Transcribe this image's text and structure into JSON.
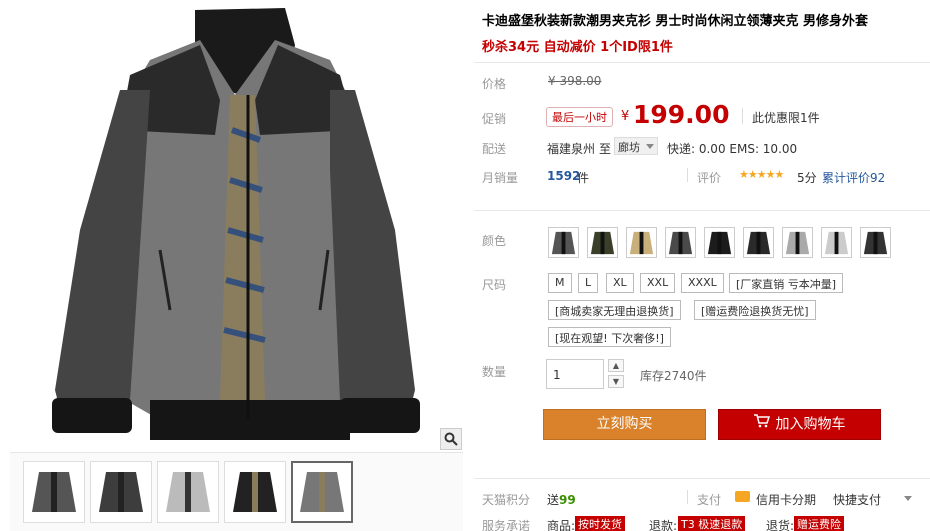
{
  "product": {
    "title": "卡迪盛堡秋装新款潮男夹克衫 男士时尚休闲立领薄夹克 男修身外套",
    "promo": "秒杀34元 自动减价 1个ID限1件"
  },
  "price": {
    "label": "价格",
    "original": "¥ 398.00",
    "promo_label": "促销",
    "promo_tag": "最后一小时",
    "currency": "¥",
    "current": "199.00",
    "limit_text": "此优惠限1件"
  },
  "shipping": {
    "label": "配送",
    "from": "福建泉州",
    "to_word": "至",
    "to_city": "廊坊",
    "fee": "快递: 0.00 EMS: 10.00"
  },
  "sales": {
    "label": "月销量",
    "count": "1592",
    "unit": "件",
    "review_label": "评价",
    "stars": "★★★★★",
    "score": "5分",
    "cum_reviews": "累计评价92"
  },
  "color": {
    "label": "颜色",
    "swatches": [
      "black-grey",
      "black-olive",
      "khaki",
      "dark-grey",
      "black",
      "black-white",
      "light-grey",
      "grey-white",
      "charcoal"
    ]
  },
  "size": {
    "label": "尺码",
    "options": [
      "M",
      "L",
      "XL",
      "XXL",
      "XXXL",
      "[厂家直销 亏本冲量]",
      "[商城卖家无理由退换货]",
      "[赠运费险退换货无忧]",
      "[现在观望! 下次奢侈!]"
    ]
  },
  "quantity": {
    "label": "数量",
    "value": "1",
    "stock": "库存2740件"
  },
  "actions": {
    "buy": "立刻购买",
    "cart": "加入购物车"
  },
  "points": {
    "label": "天猫积分",
    "prefix": "送",
    "value": "99",
    "pay_label": "支付",
    "card": "信用卡分期",
    "quick": "快捷支付"
  },
  "service": {
    "label": "服务承诺",
    "goods_label": "商品:",
    "goods_badge": "按时发货",
    "refund_label": "退款:",
    "refund_badge": "T3 极速退款",
    "return_label": "退货:",
    "return_badge": "赠运费险"
  },
  "colors": {
    "accent_red": "#c40000",
    "buy_orange": "#d9822b",
    "link_blue": "#25589c",
    "points_green": "#3a8f00"
  }
}
